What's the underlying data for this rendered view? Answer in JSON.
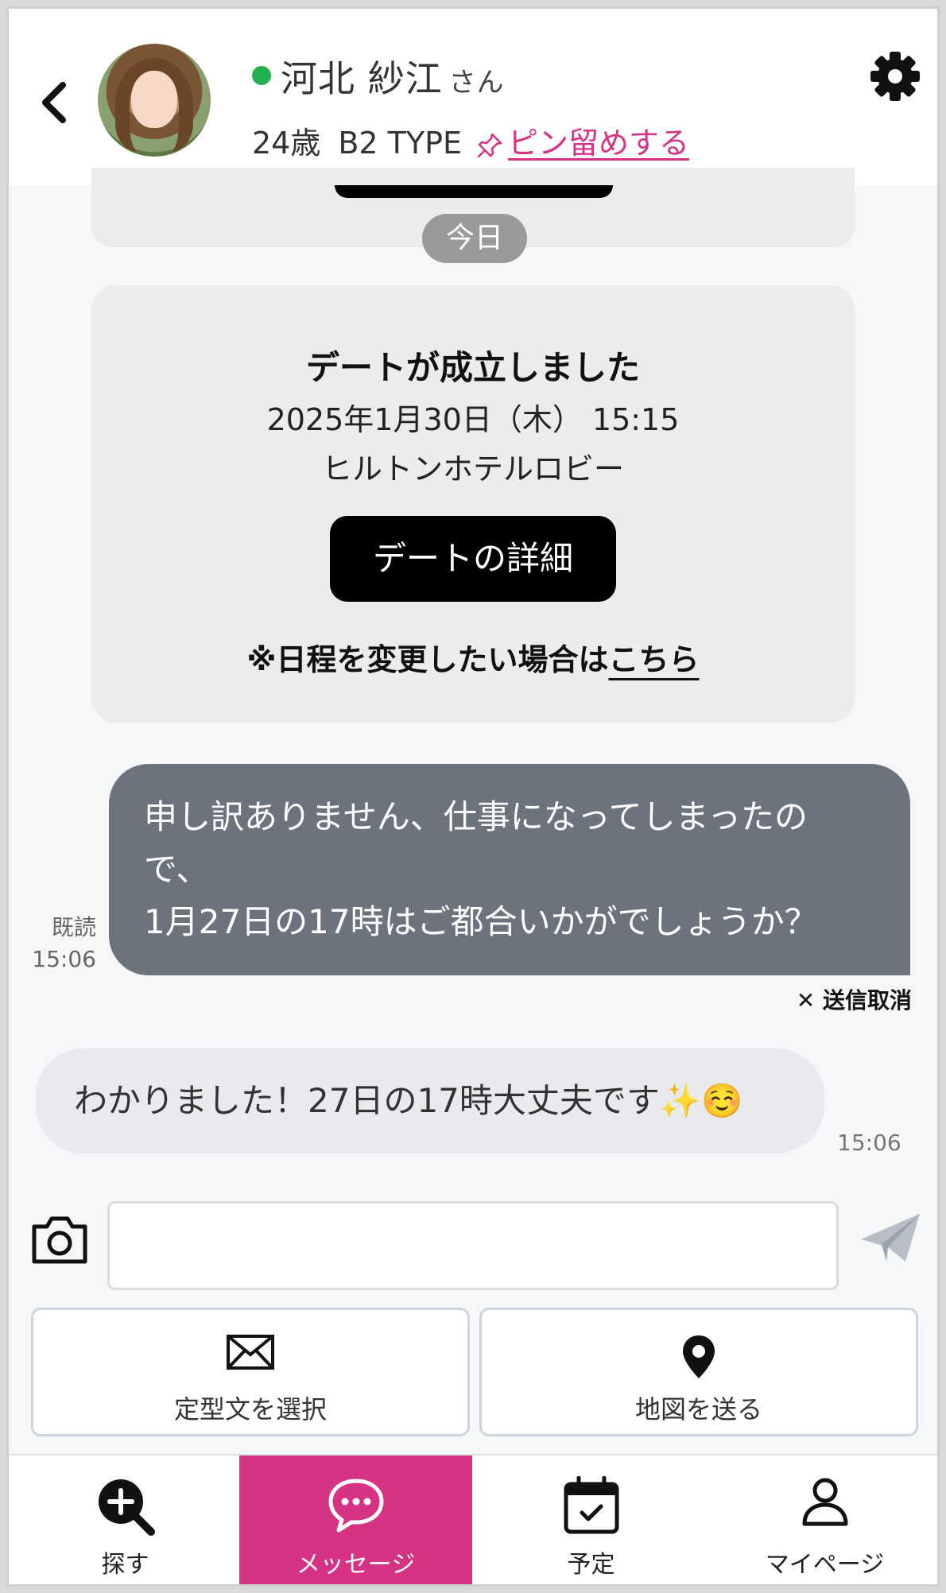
{
  "header": {
    "back_icon": "chevron-left-icon",
    "name": "河北 紗江",
    "honorific": "さん",
    "age": "24歳",
    "type": "B2 TYPE",
    "pin_label": "ピン留めする",
    "status_color": "#22b14c",
    "settings_icon": "gear-icon"
  },
  "divider": {
    "day": "今日"
  },
  "date_card": {
    "title": "デートが成立しました",
    "datetime": "2025年1月30日（木） 15:15",
    "place": "ヒルトンホテルロビー",
    "button": "デートの詳細",
    "note_prefix": "※日程を変更したい場合は",
    "note_link": "こちら"
  },
  "messages": {
    "outgoing": {
      "line1": "申し訳ありません、仕事になってしまったの",
      "line2": "で、",
      "line3": "1月27日の17時はご都合いかがでしょうか？",
      "read_label": "既読",
      "time": "15:06",
      "cancel_label": "✕ 送信取消"
    },
    "incoming": {
      "text": "わかりました！27日の17時大丈夫です✨☺️",
      "time": "15:06"
    }
  },
  "composer": {
    "camera_icon": "camera-icon",
    "input_value": "",
    "send_icon": "paper-plane-icon",
    "options": [
      {
        "label": "定型文を選択",
        "icon": "envelope-icon"
      },
      {
        "label": "地図を送る",
        "icon": "map-pin-icon"
      }
    ]
  },
  "nav": {
    "accent": "#d63384",
    "items": [
      {
        "label": "探す",
        "icon": "search-plus-icon"
      },
      {
        "label": "メッセージ",
        "icon": "chat-bubble-icon",
        "active": true
      },
      {
        "label": "予定",
        "icon": "calendar-check-icon"
      },
      {
        "label": "マイページ",
        "icon": "user-icon"
      }
    ]
  }
}
